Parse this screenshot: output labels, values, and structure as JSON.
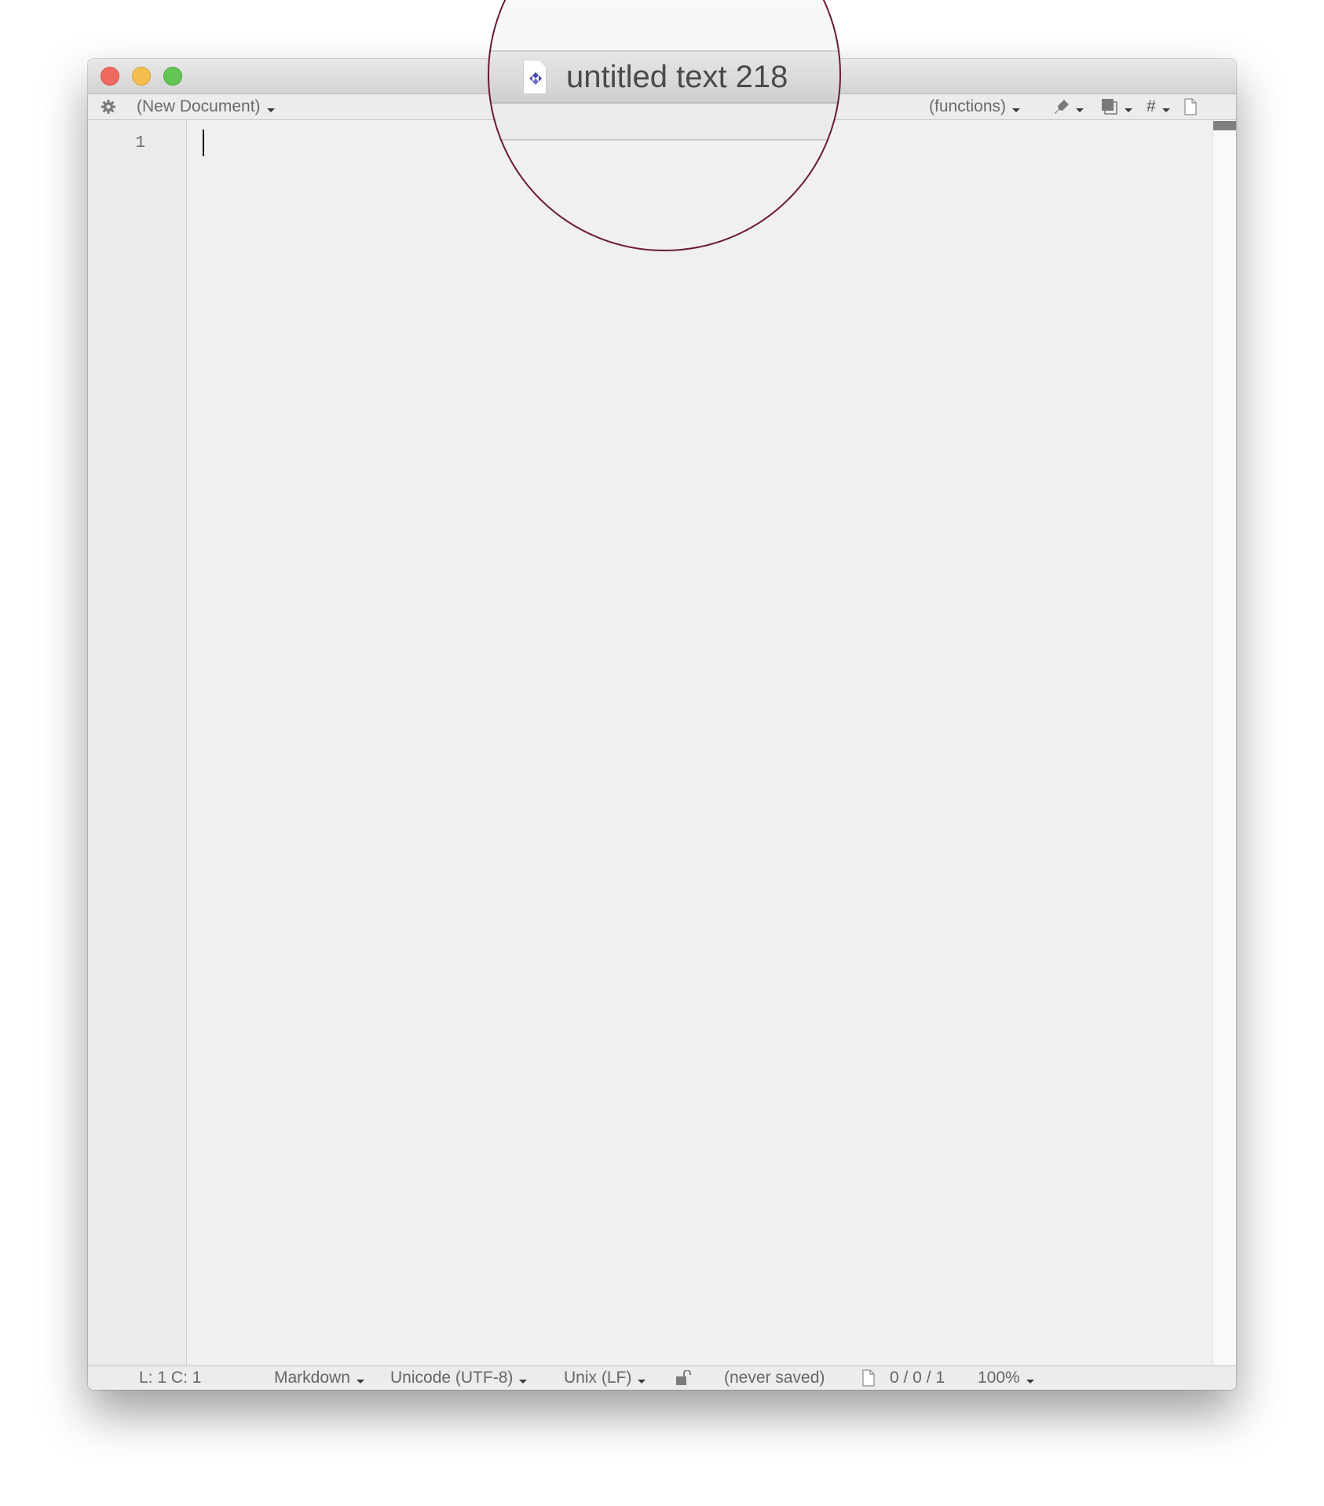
{
  "window": {
    "title": "untitled text 218",
    "traffic_lights": {
      "close": {
        "color": "#ee6a5f"
      },
      "minimize": {
        "color": "#f5bf4f"
      },
      "maximize": {
        "color": "#62c554"
      }
    }
  },
  "toolbar": {
    "settings_icon": "gear-icon",
    "document_menu": "(New Document)",
    "functions_menu": "(functions)",
    "marker_icon": "pen-icon",
    "clippings_icon": "overlapping-squares-icon",
    "hash_label": "#",
    "doc_info_icon": "document-icon"
  },
  "editor": {
    "line_numbers": [
      "1"
    ],
    "content": ""
  },
  "statusbar": {
    "position": "L: 1 C: 1",
    "language": "Markdown",
    "encoding": "Unicode (UTF-8)",
    "line_endings": "Unix (LF)",
    "lock_icon": "unlocked-icon",
    "save_state": "(never saved)",
    "doc_stats_icon": "document-icon",
    "stats": "0 / 0 / 1",
    "zoom": "100%"
  },
  "magnifier": {
    "title": "untitled text 218",
    "ring_color": "#6b1a36"
  }
}
